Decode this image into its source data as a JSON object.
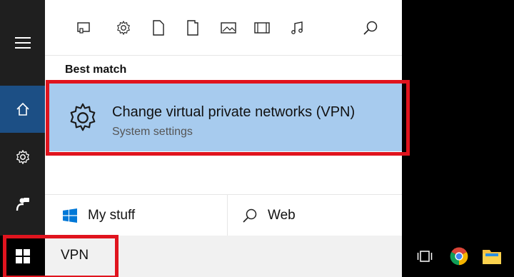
{
  "filter_bar": {
    "icons": [
      "apps-icon",
      "settings-icon",
      "documents-icon",
      "folders-icon",
      "photos-icon",
      "videos-icon",
      "music-icon",
      "search-icon"
    ]
  },
  "best_match": {
    "section_title": "Best match",
    "title": "Change virtual private networks (VPN)",
    "subtitle": "System settings",
    "icon": "gear-icon"
  },
  "bottom_links": {
    "my_stuff": "My stuff",
    "web": "Web"
  },
  "search": {
    "query": "VPN"
  },
  "colors": {
    "selection": "#a7cbee",
    "rail_active": "#1c4f85",
    "highlight": "#e0141e"
  }
}
